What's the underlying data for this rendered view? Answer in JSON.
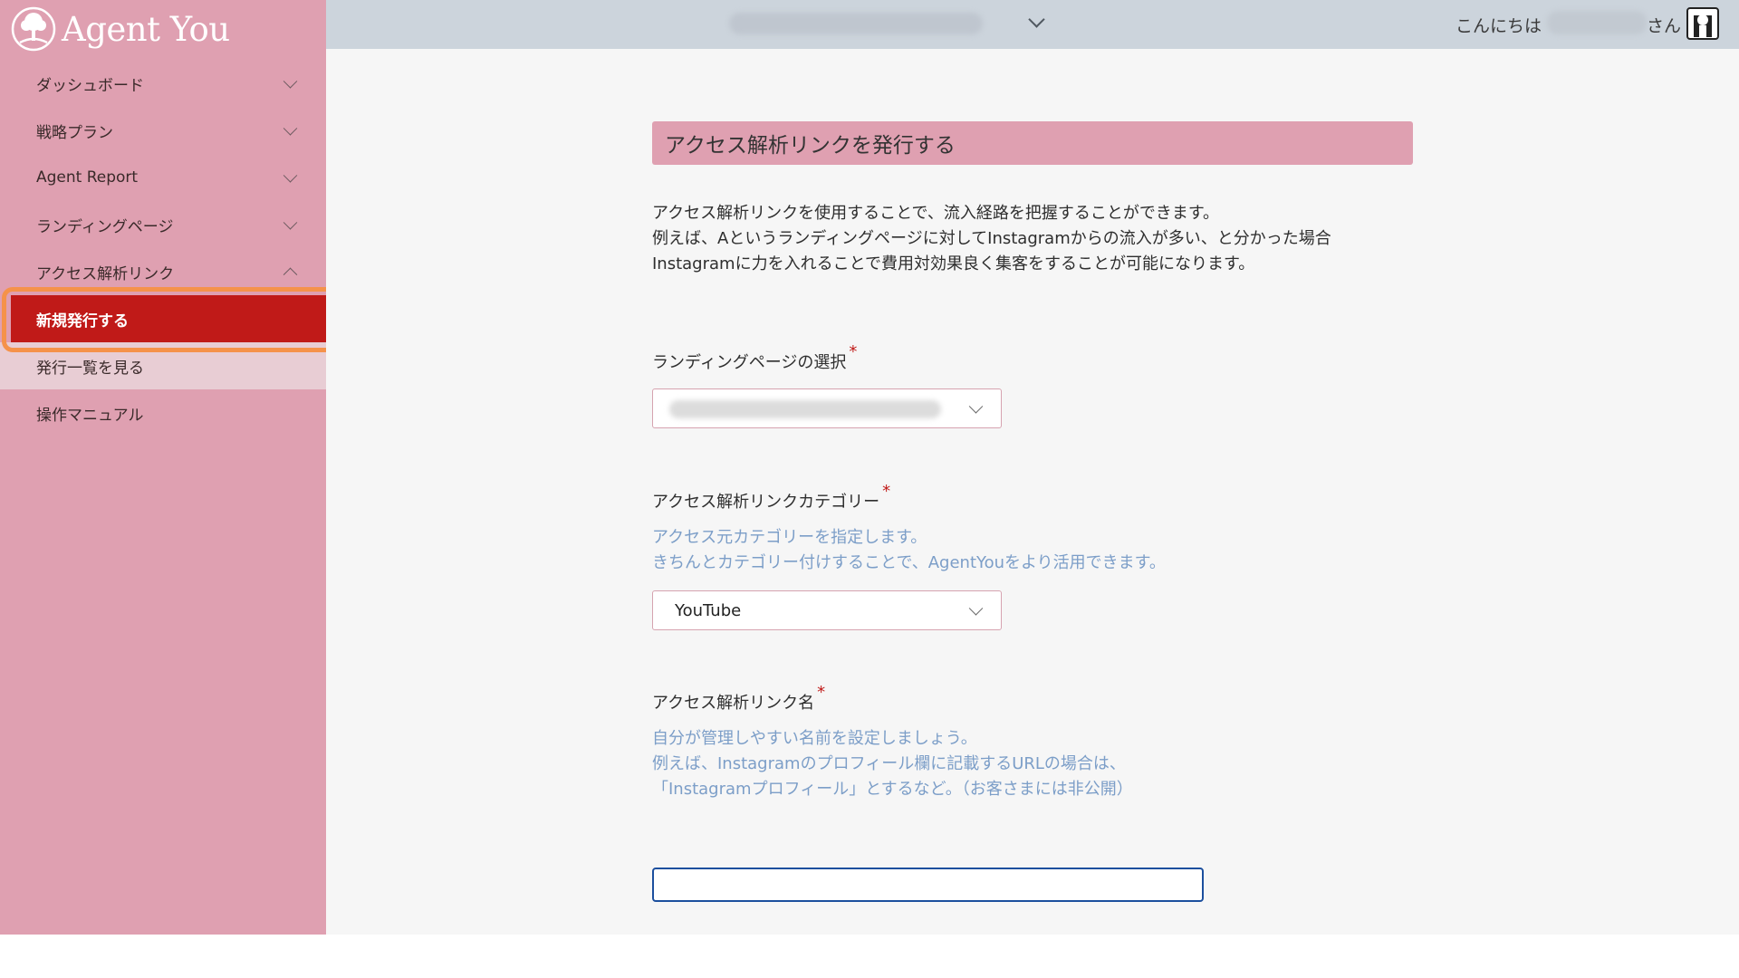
{
  "app": {
    "logo_text": "Agent You"
  },
  "sidebar": {
    "items": [
      {
        "label": "ダッシュボード"
      },
      {
        "label": "戦略プラン"
      },
      {
        "label": "Agent Report"
      },
      {
        "label": "ランディングページ"
      },
      {
        "label": "アクセス解析リンク"
      }
    ],
    "subitems": [
      {
        "label": "新規発行する",
        "active": true
      },
      {
        "label": "発行一覧を見る"
      }
    ],
    "manual": {
      "label": "操作マニュアル"
    }
  },
  "header": {
    "greeting": "こんにちは",
    "suffix": "さん"
  },
  "page": {
    "title": "アクセス解析リンクを発行する",
    "description": [
      "アクセス解析リンクを使用することで、流入経路を把握することができます。",
      "例えば、Aというランディングページに対してInstagramからの流入が多い、と分かった場合",
      "Instagramに力を入れることで費用対効果良く集客をすることが可能になります。"
    ],
    "fields": {
      "landing": {
        "label": "ランディングページの選択",
        "required_mark": "*"
      },
      "category": {
        "label": "アクセス解析リンクカテゴリー",
        "required_mark": "*",
        "help": [
          "アクセス元カテゴリーを指定します。",
          "きちんとカテゴリー付けすることで、AgentYouをより活用できます。"
        ],
        "value": "YouTube"
      },
      "name": {
        "label": "アクセス解析リンク名",
        "required_mark": "*",
        "help": [
          "自分が管理しやすい名前を設定しましょう。",
          "例えば、Instagramのプロフィール欄に記載するURLの場合は、",
          "「Instagramプロフィール」とするなど。（お客さまには非公開）"
        ],
        "value": ""
      }
    }
  },
  "colors": {
    "sidebar_bg": "#dfa0b1",
    "active_item": "#c01a18",
    "highlight_outline": "#f5924a",
    "help_text": "#7c9ec8",
    "input_focus": "#1c4f9e"
  }
}
